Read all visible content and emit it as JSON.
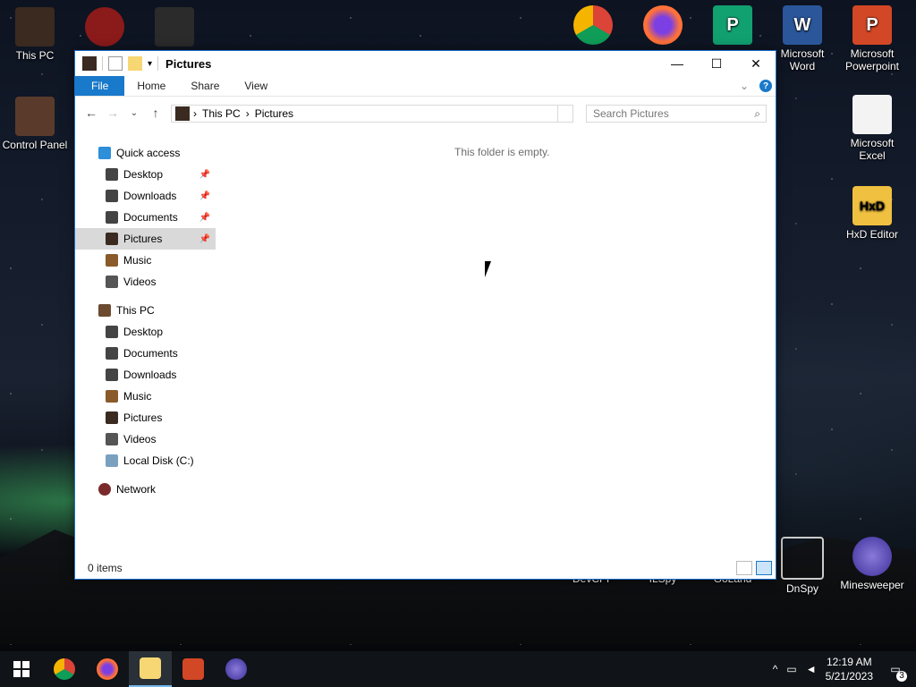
{
  "desktop": {
    "icons_left": [
      {
        "label": "This PC",
        "color": "#3a2a20"
      },
      {
        "label": "Control Panel",
        "color": "#5a3b2b"
      }
    ],
    "icons_top": [
      {
        "label": "",
        "color": "#8b1a1a"
      },
      {
        "label": "",
        "color": "#2b2b2b"
      },
      {
        "label": "",
        "color": "#ffffff"
      },
      {
        "label": "",
        "color": "#ff7139"
      },
      {
        "label": "",
        "color": "#11a070"
      },
      {
        "label": "Microsoft Word",
        "color": "#2b579a"
      },
      {
        "label": "Microsoft Powerpoint",
        "color": "#d24726"
      }
    ],
    "icons_right": [
      {
        "label": "Microsoft Excel",
        "color": "#f3f3f3"
      },
      {
        "label": "HxD Editor",
        "color": "#f0c040"
      }
    ],
    "icons_bottom": [
      {
        "label": "DevCPP"
      },
      {
        "label": "ILSpy"
      },
      {
        "label": "GoLand"
      },
      {
        "label": "DnSpy"
      },
      {
        "label": "Minesweeper"
      }
    ]
  },
  "window": {
    "title": "Pictures",
    "tabs": [
      "File",
      "Home",
      "Share",
      "View"
    ],
    "address": {
      "crumbs": [
        "This PC",
        "Pictures"
      ]
    },
    "search_placeholder": "Search Pictures",
    "empty_message": "This folder is empty.",
    "status": "0 items",
    "quick_access_label": "Quick access",
    "quick_access": [
      {
        "label": "Desktop",
        "pinned": true
      },
      {
        "label": "Downloads",
        "pinned": true
      },
      {
        "label": "Documents",
        "pinned": true
      },
      {
        "label": "Pictures",
        "pinned": true,
        "selected": true
      },
      {
        "label": "Music",
        "pinned": false
      },
      {
        "label": "Videos",
        "pinned": false
      }
    ],
    "this_pc_label": "This PC",
    "this_pc_items": [
      {
        "label": "Desktop"
      },
      {
        "label": "Documents"
      },
      {
        "label": "Downloads"
      },
      {
        "label": "Music"
      },
      {
        "label": "Pictures"
      },
      {
        "label": "Videos"
      },
      {
        "label": "Local Disk (C:)"
      }
    ],
    "network_label": "Network"
  },
  "taskbar": {
    "time": "12:19 AM",
    "date": "5/21/2023",
    "notification_count": "3"
  },
  "colors": {
    "accent": "#1979ca"
  }
}
